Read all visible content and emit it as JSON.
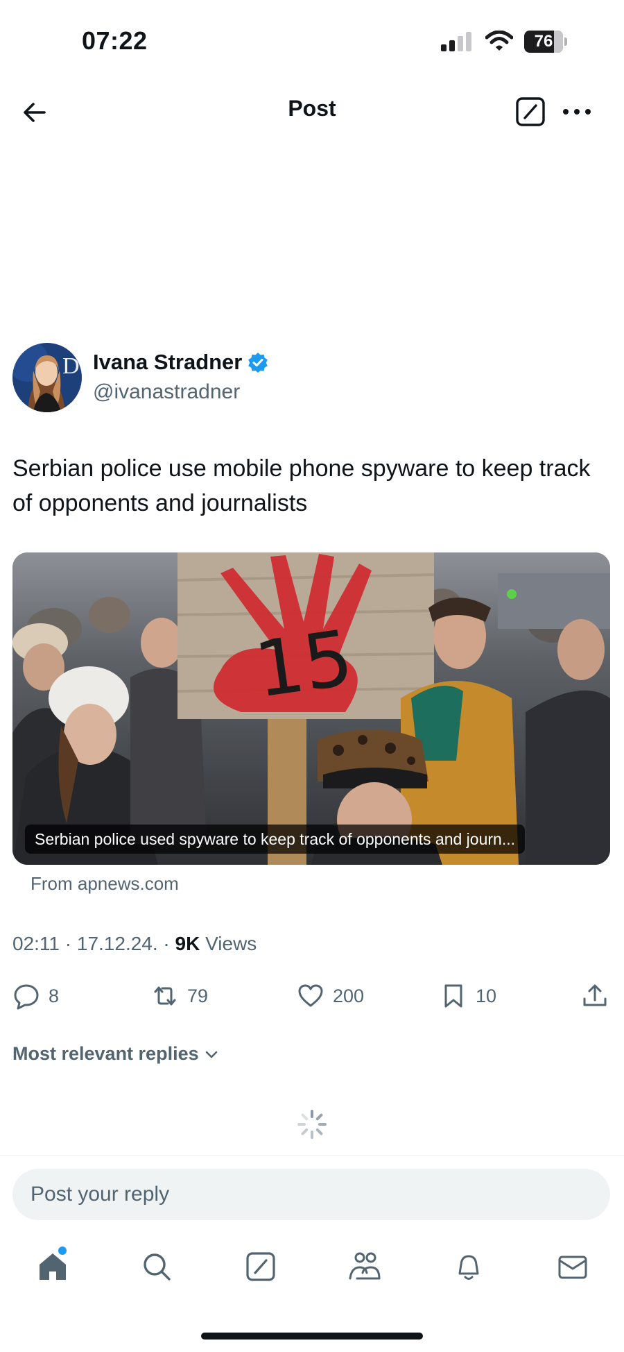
{
  "status_bar": {
    "time": "07:22",
    "battery_level": "76"
  },
  "header": {
    "title": "Post"
  },
  "author": {
    "name": "Ivana Stradner",
    "handle": "@ivanastradner",
    "verified": true
  },
  "post": {
    "text": "Serbian police use mobile phone spyware to keep track of opponents and journalists",
    "media_caption": "Serbian police used spyware to keep track of opponents and journ...",
    "source": "From apnews.com",
    "meta_time": "02:11 · 17.12.24. · ",
    "views_count": "9K",
    "views_label": " Views"
  },
  "actions": {
    "replies": "8",
    "reposts": "79",
    "likes": "200",
    "bookmarks": "10"
  },
  "replies_filter": "Most relevant replies",
  "reply_placeholder": "Post your reply",
  "colors": {
    "accent": "#1d9bf0",
    "text_secondary": "#536471",
    "text_primary": "#0f1419",
    "verified": "#1d9bf0"
  }
}
